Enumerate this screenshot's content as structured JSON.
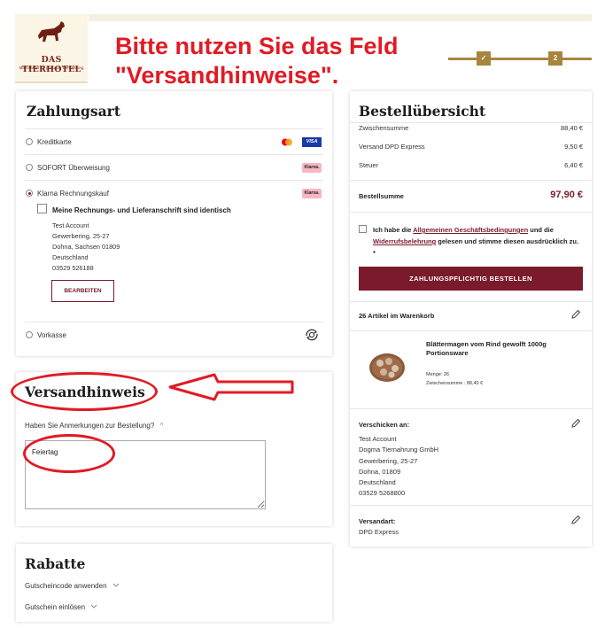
{
  "logo": {
    "brand": "DAS TIERHOTEL",
    "tagline": "Manufaktur für gesunde Tiernahrung",
    "icon": "dog-logo-icon"
  },
  "annotation": {
    "line1": "Bitte nutzen Sie das Feld",
    "line2": "\"Versandhinweise\"."
  },
  "stepper": {
    "step1": "✓",
    "step2": "2"
  },
  "payment": {
    "title": "Zahlungsart",
    "options": [
      {
        "label": "Kreditkarte",
        "selected": false
      },
      {
        "label": "SOFORT Überweisung",
        "selected": false
      },
      {
        "label": "Klarna Rechnungskauf",
        "selected": true
      },
      {
        "label": "Vorkasse",
        "selected": false
      }
    ],
    "visa_label": "VISA",
    "klarna_label": "Klarna.",
    "identical_label": "Meine Rechnungs- und Lieferanschrift sind identisch",
    "billing_address": [
      "Test Account",
      "Gewerbering, 25-27",
      "Dohna, Sachsen 01809",
      "Deutschland",
      "03529 526188"
    ],
    "edit_label": "BEARBEITEN"
  },
  "shipping_note": {
    "title": "Versandhinweis",
    "question": "Haben Sie Anmerkungen zur Bestellung?",
    "chevron": "^",
    "value": "Feiertag"
  },
  "discounts": {
    "title": "Rabatte",
    "coupon_label": "Gutscheincode anwenden",
    "voucher_label": "Gutschein einlösen"
  },
  "summary": {
    "title": "Bestellübersicht",
    "lines": [
      {
        "label": "Zwischensumme",
        "value": "88,40 €"
      },
      {
        "label": "Versand DPD Express",
        "value": "9,50 €"
      },
      {
        "label": "Steuer",
        "value": "6,40 €"
      }
    ],
    "total_label": "Bestellsumme",
    "total_value": "97,90 €",
    "agb_pre": "Ich habe die ",
    "agb_link": "Allgemeinen Geschäftsbedingungen",
    "agb_mid": " und die ",
    "revocation_link": "Widerrufsbelehrung",
    "agb_post": " gelesen und stimme diesen ausdrücklich zu. *",
    "order_button": "ZAHLUNGSPFLICHTIG BESTELLEN",
    "cart_count": "26 Artikel im Warenkorb",
    "product_name": "Blättermagen vom Rind gewolft 1000g Portionsware",
    "product_qty": "Menge:   26",
    "product_subtotal": "Zwischensumme :   88,40 €",
    "ship_to_label": "Verschicken an:",
    "ship_to": [
      "Test Account",
      "Dogma Tiernahrung GmbH",
      "Gewerbering, 25-27",
      "Dohna, 01809",
      "Deutschland",
      "03529 5268800"
    ],
    "method_label": "Versandart:",
    "method_value": "DPD Express"
  },
  "colors": {
    "accent": "#7a1a2c",
    "gold": "#a8853f",
    "annotation_red": "#e01b24"
  }
}
